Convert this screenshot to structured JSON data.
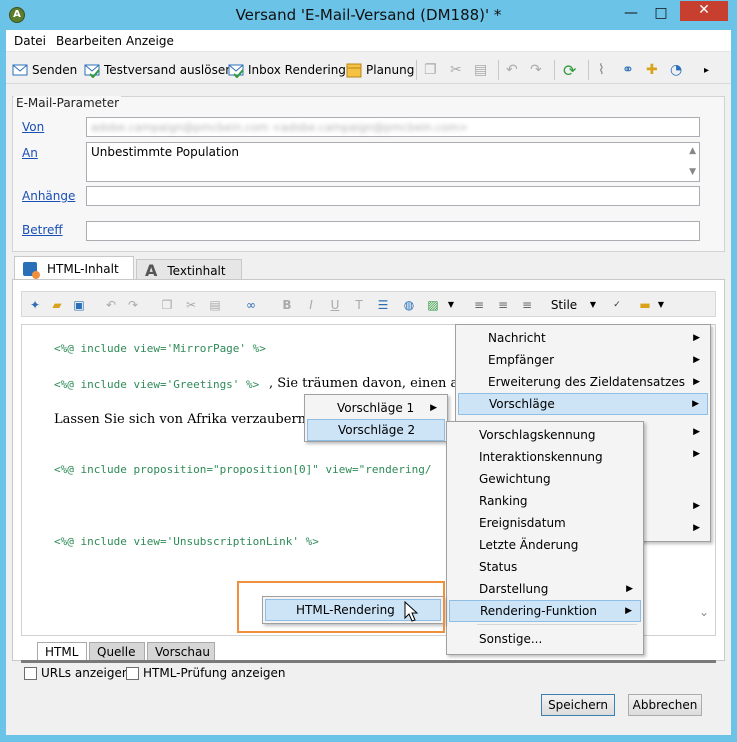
{
  "window": {
    "title": "Versand 'E-Mail-Versand (DM188)' *",
    "app_icon": "A",
    "minimize": "—",
    "maximize": "□",
    "close": "✕"
  },
  "menu": [
    "Datei",
    "Bearbeiten",
    "Anzeige"
  ],
  "toolbar": {
    "send": "Senden",
    "test_send": "Testversand auslösen",
    "inbox_rendering": "Inbox Rendering",
    "planning": "Planung",
    "more": "▸"
  },
  "email_params": {
    "legend": "E-Mail-Parameter",
    "from_label": "Von",
    "from_value": "adobe.campaign@pmcbein.com <adobe.campaign@pmcbein.com>",
    "to_label": "An",
    "to_value": "Unbestimmte Population",
    "attachments_label": "Anhänge",
    "subject_label": "Betreff"
  },
  "content_tabs": {
    "html": "HTML-Inhalt",
    "text": "Textinhalt"
  },
  "editor_toolbar": {
    "bold": "B",
    "italic": "I",
    "underline": "U",
    "styles": "Stile"
  },
  "editor": {
    "line1": "<%@ include view='MirrorPage' %>",
    "line2_code": "<%@ include view='Greetings' %>",
    "line2_text": ", Sie träumen davon, einen ande",
    "line3": "Lassen Sie sich von Afrika verzaubern und",
    "line4": "<%@ include proposition=\"proposition[0]\" view=\"rendering/",
    "line5": "<%@ include view='UnsubscriptionLink' %>"
  },
  "bottom_tabs": [
    "HTML",
    "Quelle",
    "Vorschau"
  ],
  "options": {
    "show_urls": "URLs anzeigen",
    "html_check": "HTML-Prüfung anzeigen"
  },
  "buttons": {
    "save": "Speichern",
    "cancel": "Abbrechen"
  },
  "context_menu_main": [
    "Nachricht",
    "Empfänger",
    "Erweiterung des Zieldatensatzes",
    "Vorschläge"
  ],
  "context_menu_suggestions": [
    "Vorschläge 1",
    "Vorschläge 2"
  ],
  "context_menu_fields": [
    "Vorschlagskennung",
    "Interaktionskennung",
    "Gewichtung",
    "Ranking",
    "Ereignisdatum",
    "Letzte Änderung",
    "Status",
    "Darstellung",
    "Rendering-Funktion",
    "Sonstige..."
  ],
  "context_menu_render": [
    "HTML-Rendering"
  ],
  "colors": {
    "titlebar": "#6cc3e8",
    "close": "#c7402f",
    "highlight": "#cde4f7",
    "callout": "#f0903c",
    "code": "#2e8b57",
    "link": "#1a4fb5"
  }
}
